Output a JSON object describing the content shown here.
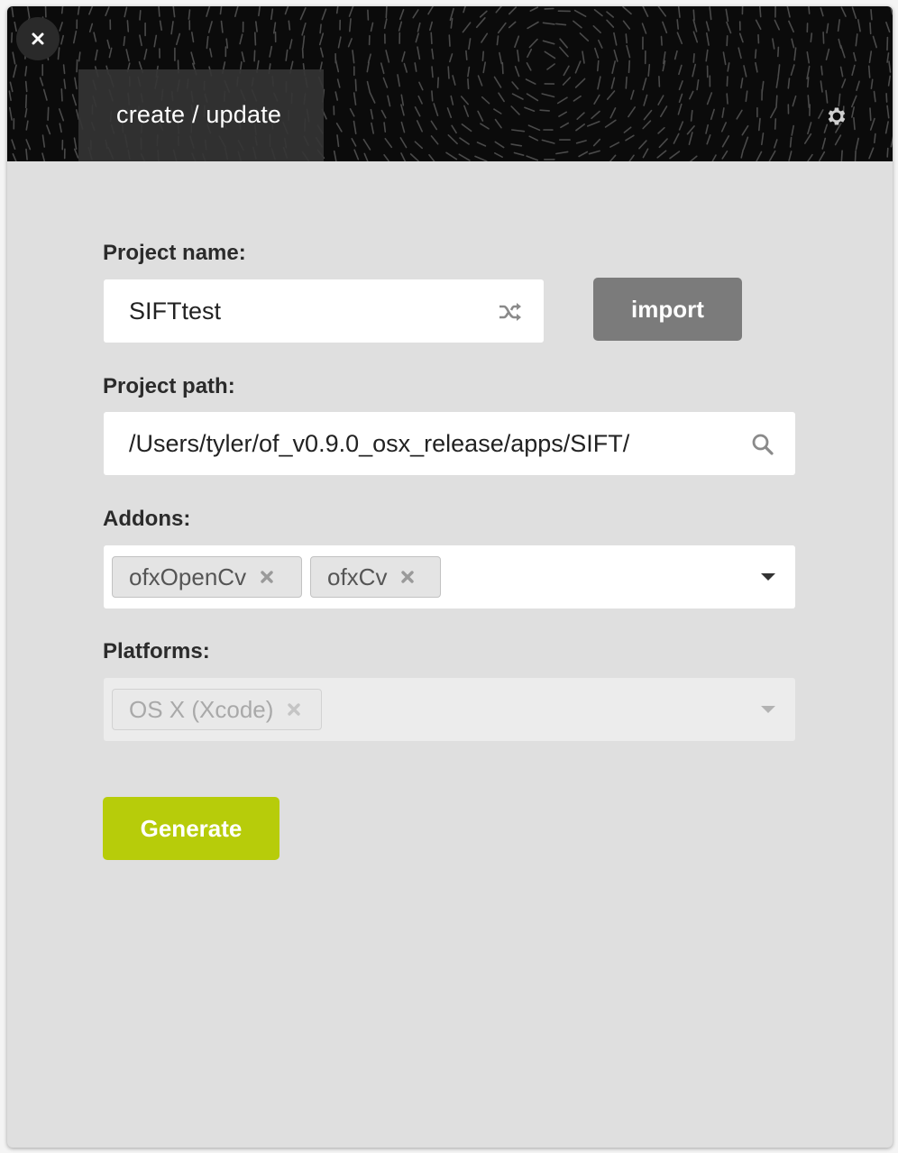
{
  "window": {
    "tab_label": "create / update",
    "close_icon": "close-icon",
    "settings_icon": "gear-icon"
  },
  "project_name": {
    "label": "Project name:",
    "value": "SIFTtest",
    "shuffle_icon": "shuffle-icon"
  },
  "import_button": {
    "label": "import"
  },
  "project_path": {
    "label": "Project path:",
    "value": "/Users/tyler/of_v0.9.0_osx_release/apps/SIFT/",
    "search_icon": "search-icon"
  },
  "addons": {
    "label": "Addons:",
    "selected": [
      "ofxOpenCv",
      "ofxCv"
    ]
  },
  "platforms": {
    "label": "Platforms:",
    "selected": [
      "OS X (Xcode)"
    ],
    "disabled": true
  },
  "generate_button": {
    "label": "Generate"
  },
  "colors": {
    "header_bg": "#0b0b0b",
    "panel_bg": "#dfdfdf",
    "import_bg": "#7b7b7b",
    "generate_bg": "#b7cc0a"
  }
}
